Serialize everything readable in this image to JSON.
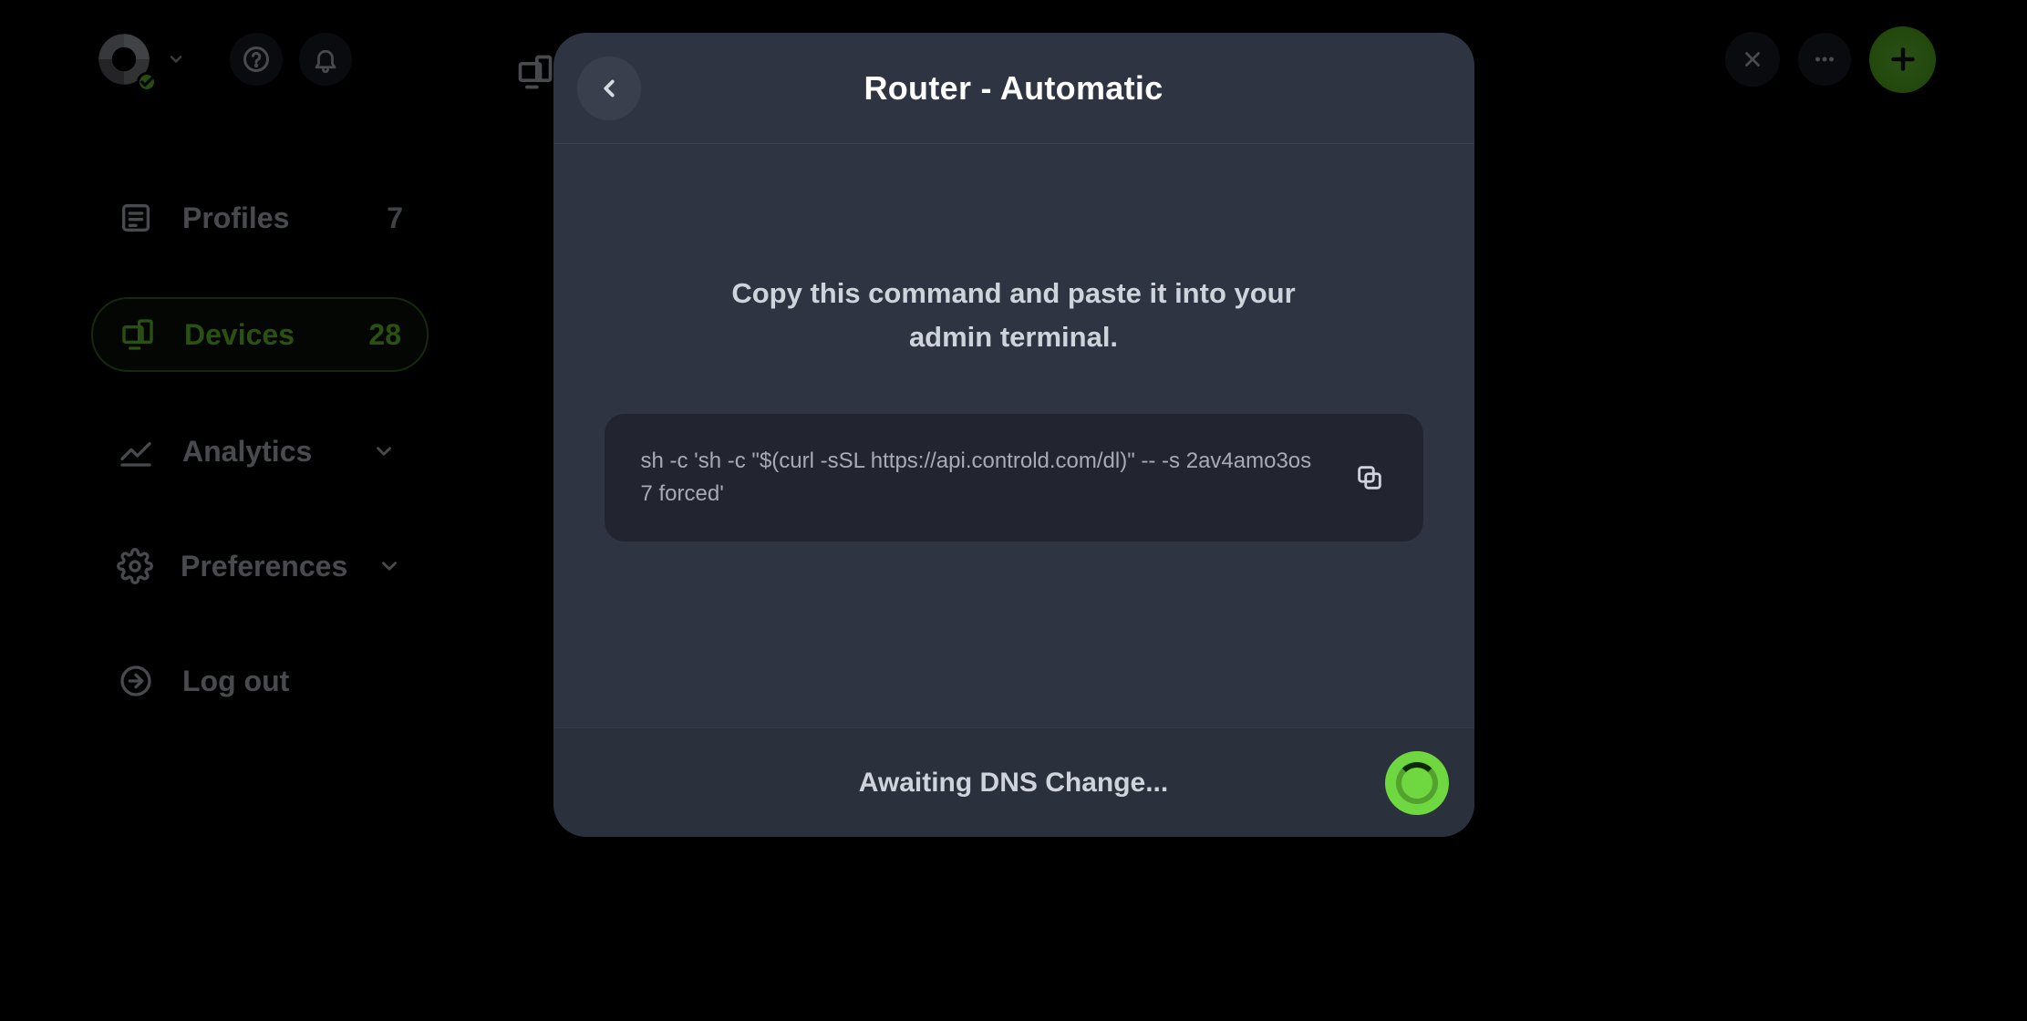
{
  "sidebar": {
    "items": [
      {
        "label": "Profiles",
        "count": "7"
      },
      {
        "label": "Devices",
        "count": "28"
      },
      {
        "label": "Analytics"
      },
      {
        "label": "Preferences"
      },
      {
        "label": "Log out"
      }
    ]
  },
  "modal": {
    "title": "Router - Automatic",
    "instruction": "Copy this command and paste it into your admin terminal.",
    "command": "sh -c 'sh -c \"$(curl -sSL https://api.controld.com/dl)\" -- -s 2av4amo3os7 forced'",
    "status": "Awaiting DNS Change..."
  }
}
